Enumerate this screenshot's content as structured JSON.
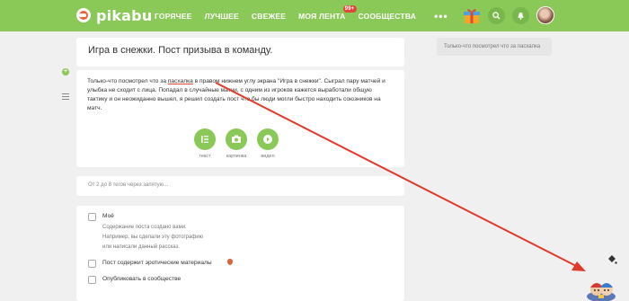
{
  "header": {
    "logo_text": "pikabu",
    "nav": [
      {
        "label": "ГОРЯЧЕЕ"
      },
      {
        "label": "ЛУЧШЕЕ"
      },
      {
        "label": "СВЕЖЕЕ"
      },
      {
        "label": "МОЯ ЛЕНТА",
        "badge": "99+"
      },
      {
        "label": "СООБЩЕСТВА"
      }
    ],
    "more_dots": "•••"
  },
  "sidebar": {
    "search_text": "Только-что  посмотрел что за пасхалка"
  },
  "post": {
    "title": "Игра в снежки. Пост призыва в команду.",
    "body_before": "Только-что  посмотрел что за ",
    "body_highlight": "пасхалка",
    "body_after": " в правом нижнем углу экрана \"Игра в снежки\". Сыграл пару матчей и улыбка не сходит с лица. Попадал в случайные матчи, с одним из игроков кажется выработали общую тактику и он неожиданно вышел, я решил создать пост что бы люди могли быстро находить союзников на матч.",
    "media": [
      {
        "label": "текст"
      },
      {
        "label": "картинка"
      },
      {
        "label": "видео"
      }
    ],
    "tags_placeholder": "От 2 до 8 тегов через запятую..."
  },
  "options": {
    "mine_label": "Моё",
    "mine_desc_1": "Содержание поста создано вами.",
    "mine_desc_2": "Например, вы сделали эту фотографию",
    "mine_desc_3": "или написали данный рассказ.",
    "erotic_label": "Пост содержит эротические материалы",
    "community_label": "Опубликовать в сообществе"
  },
  "colors": {
    "brand_green": "#8ac858",
    "accent_red": "#e0463a",
    "annotation_arrow": "#e03a2a"
  }
}
